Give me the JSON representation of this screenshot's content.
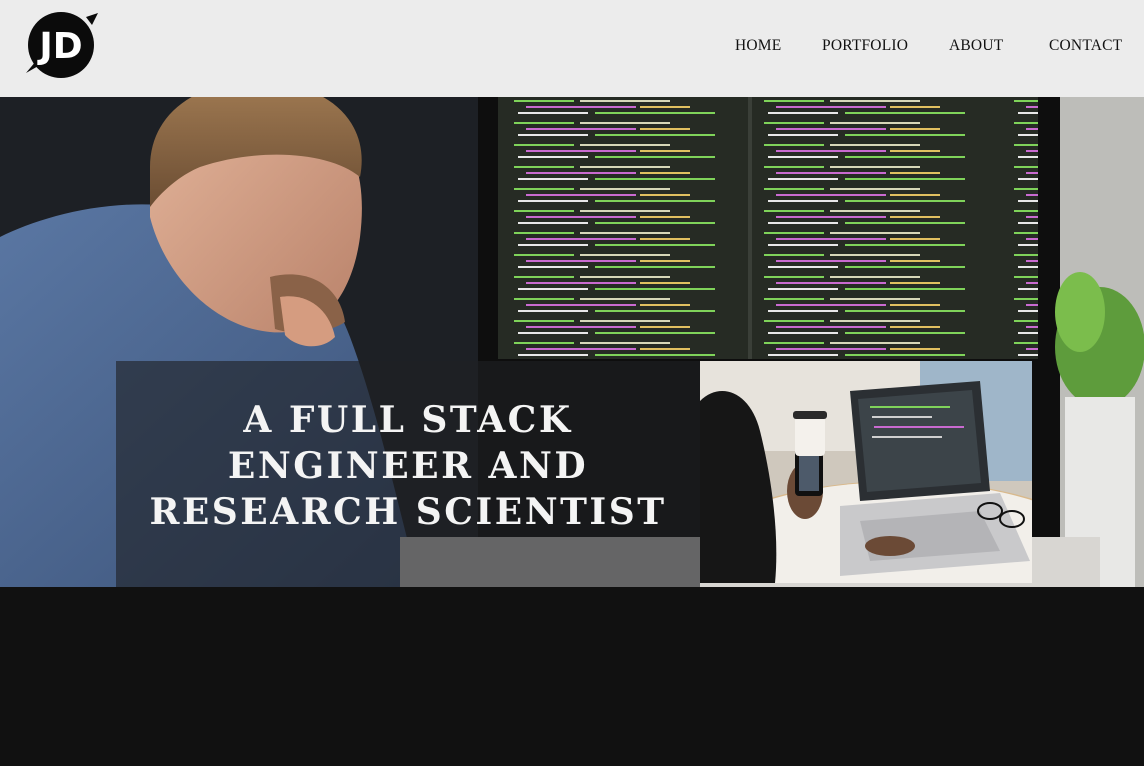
{
  "logo": {
    "text": "JD",
    "icon": "jd-logo-icon"
  },
  "nav": {
    "items": [
      {
        "label": "HOME"
      },
      {
        "label": "PORTFOLIO"
      },
      {
        "label": "ABOUT"
      },
      {
        "label": "CONTACT"
      }
    ]
  },
  "hero": {
    "heading_line1": "A FULL STACK",
    "heading_line2": "ENGINEER AND",
    "heading_line3": "RESEARCH SCIENTIST",
    "background_image": "developer-at-monitor-photo",
    "side_image": "laptop-and-phone-photo"
  },
  "colors": {
    "header_bg": "#ececec",
    "page_bg": "#111111",
    "heading_text": "#f4f4f4",
    "code_green": "#7fd35a"
  }
}
